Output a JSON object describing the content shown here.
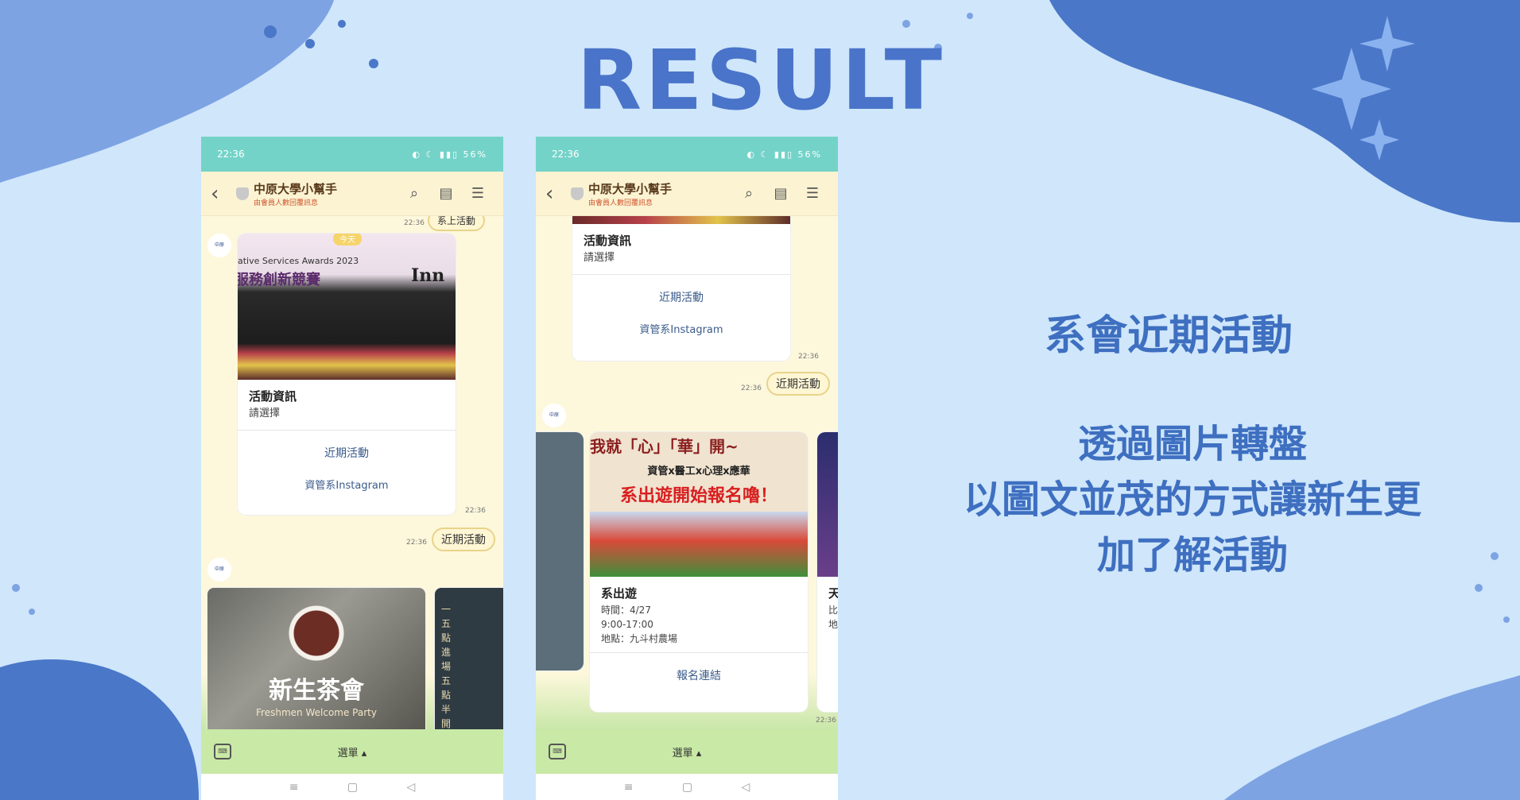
{
  "page": {
    "title": "RESULT"
  },
  "colors": {
    "background": "#cfe6fb",
    "accent": "#4a74c9",
    "statusbar": "#74d3c8",
    "menubar": "#c9e9a6",
    "chat_bg": "#fdf8dc"
  },
  "side_text": {
    "heading": "系會近期活動",
    "line1": "透過圖片轉盤",
    "line2": "以圖文並茂的方式讓新生更",
    "line3": "加了解活動"
  },
  "phone1": {
    "status": {
      "time": "22:36",
      "battery": "56%"
    },
    "header": {
      "name": "中原大學小幫手",
      "subtitle": "由會員人數回覆訊息"
    },
    "top_bubble": "系上活動",
    "today_label": "今天",
    "card": {
      "banner": "ative Services Awards 2023",
      "banner2": "服務創新競賽",
      "banner3": "Inn",
      "title": "活動資訊",
      "subtitle": "請選擇",
      "actions": [
        "近期活動",
        "資管系Instagram"
      ],
      "time": "22:36"
    },
    "reply": {
      "label": "近期活動",
      "time": "22:36"
    },
    "carousel": {
      "item1_title": "新生茶會",
      "item1_sub": "Freshmen Welcome Party",
      "item2_text": "一五點進場五點半開"
    },
    "menu_label": "選單 ▴"
  },
  "phone2": {
    "status": {
      "time": "22:36",
      "battery": "56%"
    },
    "header": {
      "name": "中原大學小幫手",
      "subtitle": "由會員人數回覆訊息"
    },
    "card": {
      "title": "活動資訊",
      "subtitle": "請選擇",
      "actions": [
        "近期活動",
        "資管系Instagram"
      ],
      "time": "22:36"
    },
    "reply": {
      "label": "近期活動",
      "time": "22:36"
    },
    "event": {
      "banner_top": "我就「心」「華」開~",
      "banner_mid": "資管x醫工x心理x應華",
      "banner_big": "系出遊開始報名嚕！",
      "title": "系出遊",
      "time_line": "時間：4/27",
      "hours": "9:00-17:00",
      "place": "地點：九斗村農場",
      "action": "報名連結",
      "side_title": "天",
      "side_sub1": "比",
      "side_sub2": "地",
      "time": "22:36"
    },
    "menu_label": "選單 ▴"
  },
  "icons": [
    "back-icon",
    "search-icon",
    "notes-icon",
    "menu-icon",
    "keyboard-icon",
    "home-icon",
    "recents-icon",
    "nav-back-icon"
  ]
}
